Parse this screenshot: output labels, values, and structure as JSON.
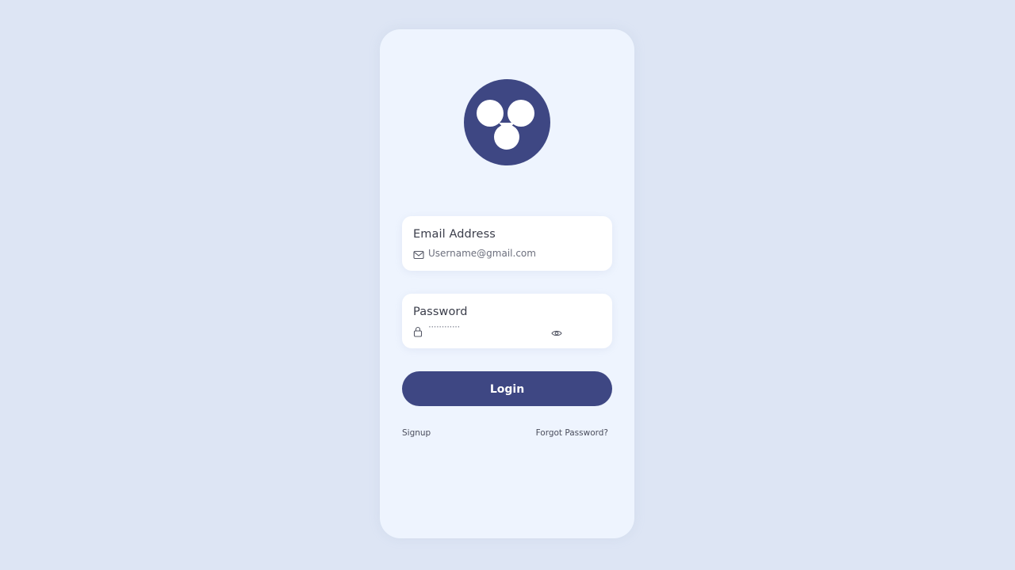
{
  "logo": {
    "icon": "three-circles-logo-icon",
    "color": "#3e4783"
  },
  "email": {
    "label": "Email Address",
    "value": "Username@gmail.com",
    "icon": "mail-icon"
  },
  "password": {
    "label": "Password",
    "value": "············",
    "icon": "lock-icon",
    "toggle_icon": "eye-icon"
  },
  "login": {
    "label": "Login"
  },
  "links": {
    "signup": "Signup",
    "forgot": "Forgot Password?"
  },
  "colors": {
    "background": "#dde5f4",
    "card": "#eef4fe",
    "accent": "#3e4783"
  }
}
